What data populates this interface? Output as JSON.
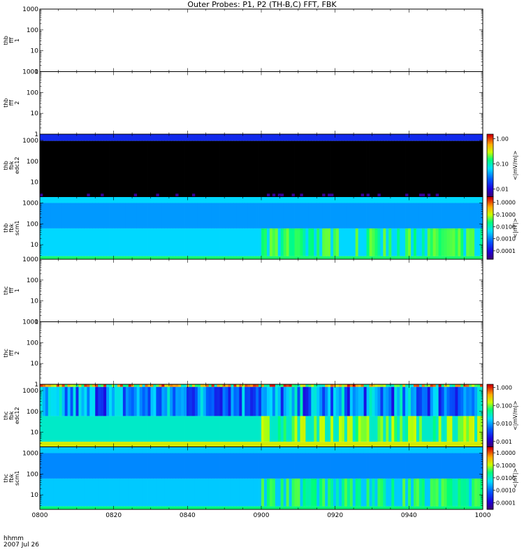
{
  "title": "Outer Probes: P1, P2 (TH-B,C) FFT, FBK",
  "footer": {
    "line1": "hhmm",
    "line2": "2007 Jul 26"
  },
  "x_axis": {
    "ticks": [
      {
        "label": "0800",
        "minute": 0
      },
      {
        "label": "0820",
        "minute": 20
      },
      {
        "label": "0840",
        "minute": 40
      },
      {
        "label": "0900",
        "minute": 60
      },
      {
        "label": "0920",
        "minute": 80
      },
      {
        "label": "0940",
        "minute": 100
      },
      {
        "label": "1000",
        "minute": 120
      }
    ]
  },
  "chart_data": [
    {
      "type": "heatmap",
      "name": "thb fff 1",
      "ylabel": [
        "thb",
        "fff",
        "1"
      ],
      "yscale": "log",
      "ylim": [
        1,
        1000
      ],
      "yticks": [
        "1",
        "10",
        "100",
        "1000"
      ],
      "has_data": false
    },
    {
      "type": "heatmap",
      "name": "thb fff 2",
      "ylabel": [
        "thb",
        "fff",
        "2"
      ],
      "yscale": "log",
      "ylim": [
        1,
        1000
      ],
      "yticks": [
        "1",
        "10",
        "100",
        "1000"
      ],
      "has_data": false
    },
    {
      "type": "heatmap",
      "name": "thb fbk edc12",
      "ylabel": [
        "thb",
        "fbk",
        "edc12"
      ],
      "yscale": "log",
      "ylim": [
        2,
        2000
      ],
      "yticks": [
        "10",
        "100",
        "1000"
      ],
      "has_data": true,
      "colorbar": {
        "label": "<|mV/m|>",
        "ticks": [
          "0.01",
          "0.10",
          "1.00"
        ],
        "range": [
          0.005,
          1.5
        ]
      },
      "bands": [
        {
          "from": 950,
          "to": 2000,
          "level": 0.015
        },
        {
          "from": 2,
          "to": 950,
          "level": 0
        },
        {
          "from": 2,
          "to": 2.8,
          "level": 0.006,
          "pattern": "sparse"
        }
      ]
    },
    {
      "type": "heatmap",
      "name": "thb fbk scm1",
      "ylabel": [
        "thb",
        "fbk",
        "scm1"
      ],
      "yscale": "log",
      "ylim": [
        2,
        2000
      ],
      "yticks": [
        "10",
        "100",
        "1000"
      ],
      "has_data": true,
      "colorbar": {
        "label": "<|nT|>",
        "ticks": [
          "0.0001",
          "0.0010",
          "0.0100",
          "0.1000",
          "1.0000"
        ],
        "range": [
          2e-05,
          3
        ]
      },
      "bands": [
        {
          "from": 1000,
          "to": 2000,
          "level": 0.004
        },
        {
          "from": 60,
          "to": 1000,
          "level": 0.0015
        },
        {
          "from": 2.8,
          "to": 60,
          "level": 0.004,
          "active_after": 60,
          "active_level": 0.03
        },
        {
          "from": 2,
          "to": 2.8,
          "level": 0.03
        }
      ]
    },
    {
      "type": "heatmap",
      "name": "thc fff 1",
      "ylabel": [
        "thc",
        "fff",
        "1"
      ],
      "yscale": "log",
      "ylim": [
        1,
        1000
      ],
      "yticks": [
        "1",
        "10",
        "100",
        "1000"
      ],
      "has_data": false
    },
    {
      "type": "heatmap",
      "name": "thc fff 2",
      "ylabel": [
        "thc",
        "fff",
        "2"
      ],
      "yscale": "log",
      "ylim": [
        1,
        1000
      ],
      "yticks": [
        "1",
        "10",
        "100",
        "1000"
      ],
      "has_data": false
    },
    {
      "type": "heatmap",
      "name": "thc fbk edc12",
      "ylabel": [
        "thc",
        "fbk",
        "edc12"
      ],
      "yscale": "log",
      "ylim": [
        2,
        2000
      ],
      "yticks": [
        "10",
        "100",
        "1000"
      ],
      "has_data": true,
      "colorbar": {
        "label": "<|mV/m|>",
        "ticks": [
          "0.001",
          "0.010",
          "0.100",
          "1.000"
        ],
        "range": [
          0.0005,
          1.5
        ]
      },
      "bands": [
        {
          "from": 1500,
          "to": 2000,
          "level": 0.3,
          "pattern": "noisy"
        },
        {
          "from": 60,
          "to": 1500,
          "level": 0.01,
          "pattern": "streaky"
        },
        {
          "from": 3.5,
          "to": 60,
          "level": 0.03,
          "active_after": 60,
          "active_level": 0.1
        },
        {
          "from": 2,
          "to": 3.5,
          "level": 0.2
        }
      ]
    },
    {
      "type": "heatmap",
      "name": "thc fbk scm1",
      "ylabel": [
        "thc",
        "fbk",
        "scm1"
      ],
      "yscale": "log",
      "ylim": [
        2,
        2000
      ],
      "yticks": [
        "10",
        "100",
        "1000"
      ],
      "has_data": true,
      "colorbar": {
        "label": "<|nT|>",
        "ticks": [
          "0.0001",
          "0.0010",
          "0.0100",
          "0.1000",
          "1.0000"
        ],
        "range": [
          3e-05,
          3
        ]
      },
      "bands": [
        {
          "from": 1000,
          "to": 2000,
          "level": 0.004
        },
        {
          "from": 60,
          "to": 1000,
          "level": 0.0015
        },
        {
          "from": 2.8,
          "to": 60,
          "level": 0.004,
          "active_after": 60,
          "active_level": 0.03
        },
        {
          "from": 2,
          "to": 2.8,
          "level": 0.03
        }
      ]
    }
  ]
}
